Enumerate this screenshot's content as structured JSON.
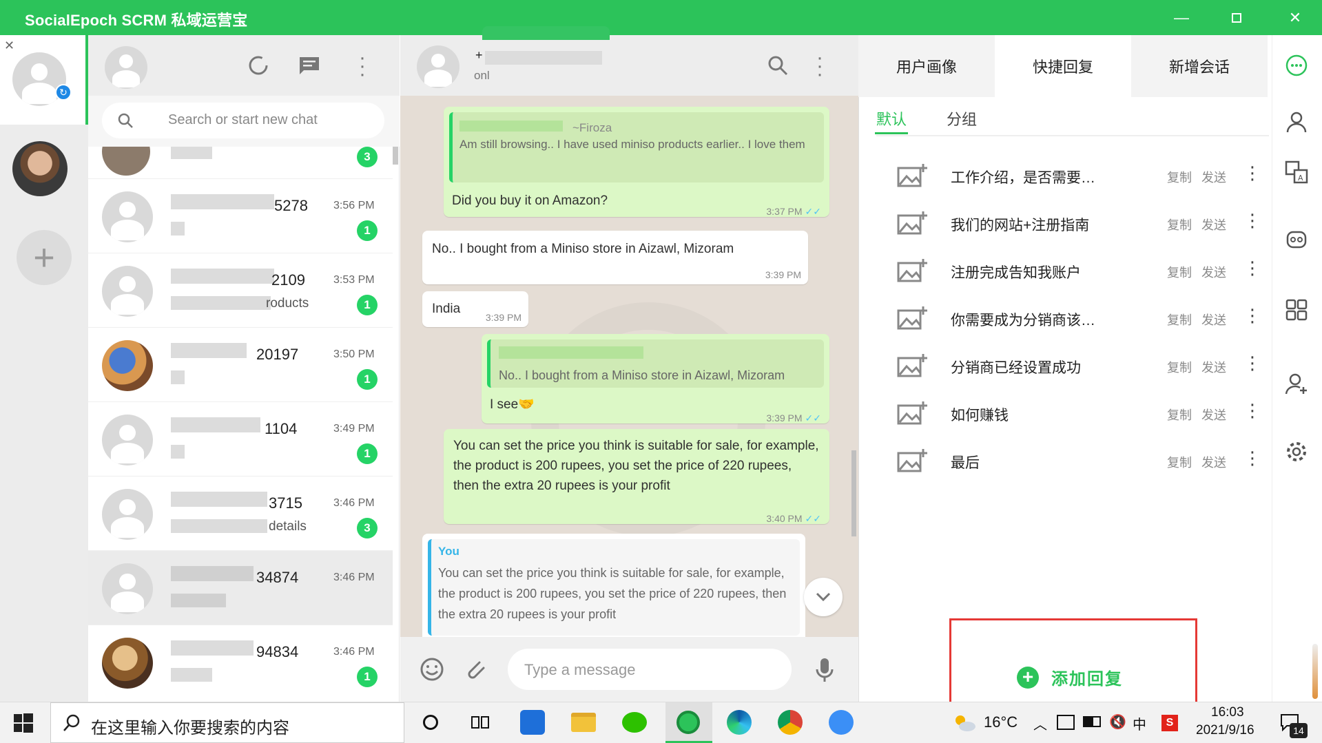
{
  "app": {
    "title": "SocialEpoch SCRM 私域运营宝"
  },
  "chat_list": {
    "search_placeholder": "Search or start new chat",
    "chats": [
      {
        "name_suffix": "",
        "time": "",
        "preview": "",
        "unread": "3"
      },
      {
        "name_suffix": "5278",
        "time": "3:56 PM",
        "preview": "",
        "unread": "1"
      },
      {
        "name_suffix": "2109",
        "time": "3:53 PM",
        "preview": "roducts",
        "unread": "1"
      },
      {
        "name_suffix": "20197",
        "time": "3:50 PM",
        "preview": "",
        "unread": "1"
      },
      {
        "name_suffix": "1104",
        "time": "3:49 PM",
        "preview": "",
        "unread": "1"
      },
      {
        "name_suffix": "3715",
        "time": "3:46 PM",
        "preview": "details",
        "unread": "3"
      },
      {
        "name_suffix": "34874",
        "time": "3:46 PM",
        "preview": "",
        "unread": ""
      },
      {
        "name_suffix": "94834",
        "time": "3:46 PM",
        "preview": "",
        "unread": "1"
      }
    ]
  },
  "conversation": {
    "contact_prefix": "+",
    "status": "onl",
    "messages": [
      {
        "quote_author": "~Firoza",
        "quote_text": "Am still browsing.. I have used miniso products earlier.. I love them",
        "text": "Did you buy it on Amazon?",
        "time": "3:37 PM"
      },
      {
        "text": "No.. I bought from a Miniso store in Aizawl, Mizoram",
        "time": "3:39 PM"
      },
      {
        "text": "India",
        "time": "3:39 PM"
      },
      {
        "quote_text": "No.. I bought from a Miniso store in Aizawl, Mizoram",
        "text": "I see🤝",
        "time": "3:39 PM"
      },
      {
        "text": "You can set the price you think is suitable for sale, for example, the product is 200 rupees, you set the price of 220 rupees, then the extra 20 rupees is your profit",
        "time": "3:40 PM"
      }
    ],
    "reply_preview": {
      "author": "You",
      "text": "You can set the price you think is suitable for sale, for example, the product is 200 rupees, you set the price of 220 rupees, then the extra 20 rupees is your profit"
    },
    "input_placeholder": "Type a message",
    "ticks": "✓✓"
  },
  "right_panel": {
    "tabs": [
      "用户画像",
      "快捷回复",
      "新增会话"
    ],
    "subtabs": [
      "默认",
      "分组"
    ],
    "copy_label": "复制",
    "send_label": "发送",
    "replies": [
      "工作介绍，是否需要…",
      "我们的网站+注册指南",
      "注册完成告知我账户",
      "你需要成为分销商该…",
      "分销商已经设置成功",
      "如何赚钱",
      "最后"
    ],
    "add_reply_label": "添加回复"
  },
  "taskbar": {
    "search_placeholder": "在这里输入你要搜索的内容",
    "weather": "16°C",
    "ime": "中",
    "time": "16:03",
    "date": "2021/9/16",
    "notification_count": "14"
  },
  "colors": {
    "brand_green": "#2cc35a",
    "bubble_out": "#dcf8c6",
    "chat_bg": "#e5ddd5",
    "badge_green": "#25d366",
    "highlight_red": "#e53935"
  }
}
